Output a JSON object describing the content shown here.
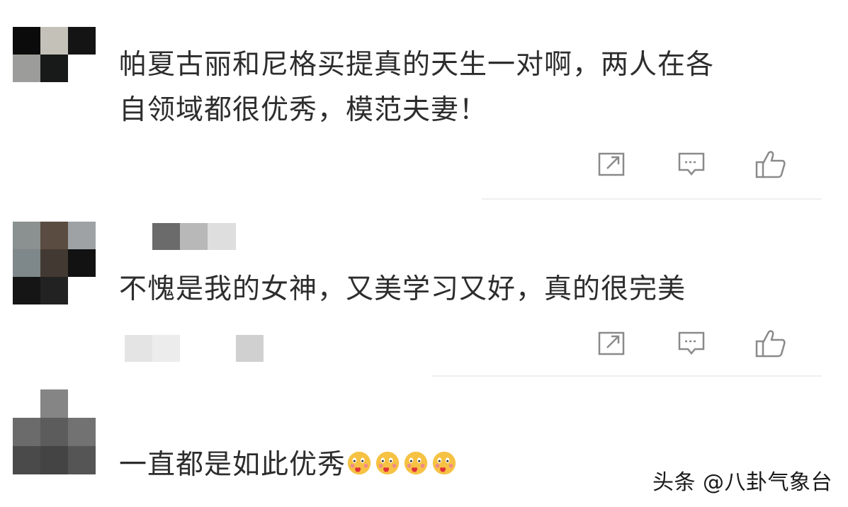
{
  "comments": [
    {
      "text_line1": "帕夏古丽和尼格买提真的天生一对啊，两人在各",
      "text_line2": "自领域都很优秀，模范夫妻！",
      "avatar_icon": "pixelated-avatar",
      "actions": [
        "share-icon",
        "reply-icon",
        "like-icon"
      ]
    },
    {
      "text_line1": "不愧是我的女神，又美学习又好，真的很完美",
      "avatar_icon": "pixelated-avatar",
      "actions": [
        "share-icon",
        "reply-icon",
        "like-icon"
      ]
    },
    {
      "text_line1": "一直都是如此优秀",
      "avatar_icon": "pixelated-avatar",
      "emoji": [
        "shy-face-emoji",
        "shy-face-emoji",
        "shy-face-emoji",
        "shy-face-emoji"
      ]
    }
  ],
  "watermark": "头条 @八卦气象台",
  "colors": {
    "text": "#2d2d2d",
    "icon": "#8a8a8a",
    "divider": "#efefef"
  }
}
